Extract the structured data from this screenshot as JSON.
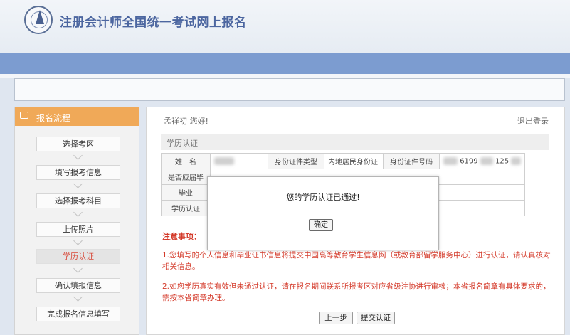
{
  "site": {
    "title": "注册会计师全国统一考试网上报名"
  },
  "sidebar": {
    "title": "报名流程",
    "steps": [
      {
        "label": "选择考区"
      },
      {
        "label": "填写报考信息"
      },
      {
        "label": "选择报考科目"
      },
      {
        "label": "上传照片"
      },
      {
        "label": "学历认证",
        "active": true
      },
      {
        "label": "确认填报信息"
      },
      {
        "label": "完成报名信息填写"
      }
    ]
  },
  "main": {
    "greeting": "孟祥初 您好!",
    "logout": "退出登录",
    "section_title": "学历认证",
    "table": {
      "name_label": "姓　名",
      "id_type_label": "身份证件类型",
      "id_type_value": "内地居民身份证",
      "id_number_label": "身份证件号码",
      "id_number_value_a": "6199",
      "id_number_value_b": "125",
      "row2_label": "是否应届毕",
      "row3_label": "毕业",
      "row4_label": "学历认证"
    },
    "notes_title": "注意事项：",
    "note1": "1.您填写的个人信息和毕业证书信息将提交中国高等教育学生信息网（或教育部留学服务中心）进行认证，请认真核对相关信息。",
    "note2": "2.如您学历真实有效但未通过认证，请在报名期间联系所报考区对应省级注协进行审核；本省报名简章有具体要求的，需按本省简章办理。",
    "prev_button": "上一步",
    "submit_button": "提交认证"
  },
  "modal": {
    "message": "您的学历认证已通过!",
    "ok_button": "确定"
  },
  "colors": {
    "accent_orange": "#f0a958",
    "nav_blue": "#7c9cd0",
    "warning_red": "#d43a2a",
    "title_blue": "#4c66a0"
  },
  "icons": {
    "logo": "cicpa-logo",
    "sidebar": "monitor-icon",
    "chevron": "chevron-down-icon"
  }
}
